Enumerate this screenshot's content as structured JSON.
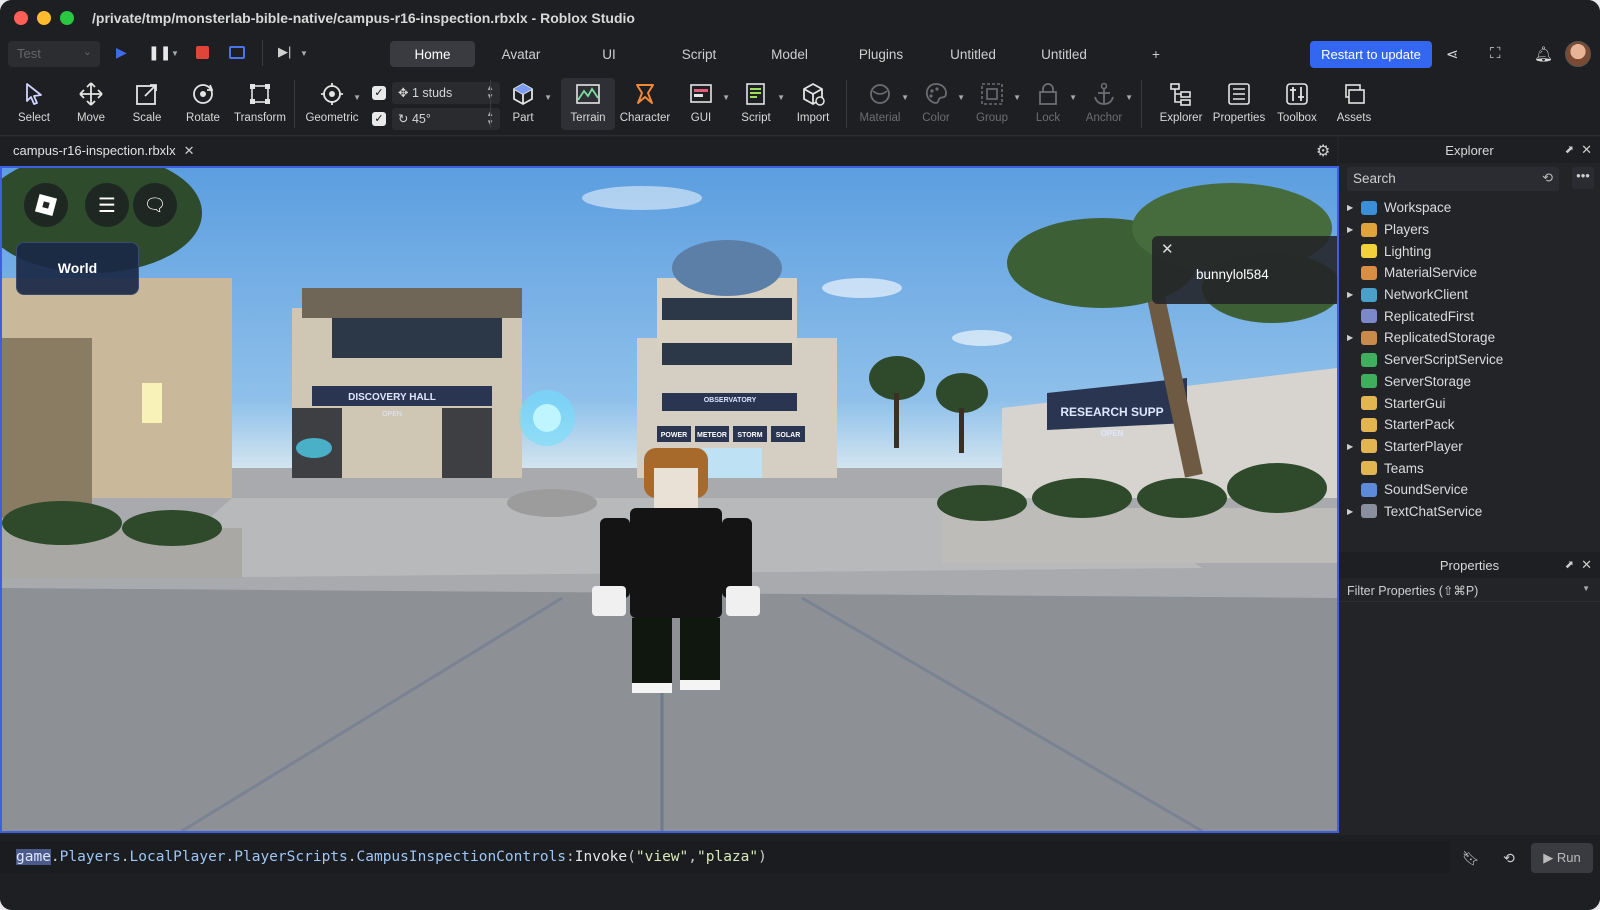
{
  "window": {
    "title": "/private/tmp/monsterlab-bible-native/campus-r16-inspection.rbxlx - Roblox Studio"
  },
  "menubar": {
    "mode_select": "Test",
    "tabs": [
      {
        "label": "Home",
        "active": true
      },
      {
        "label": "Avatar",
        "active": false
      },
      {
        "label": "UI",
        "active": false
      },
      {
        "label": "Script",
        "active": false
      },
      {
        "label": "Model",
        "active": false
      },
      {
        "label": "Plugins",
        "active": false
      },
      {
        "label": "Untitled",
        "active": false
      },
      {
        "label": "Untitled",
        "active": false
      },
      {
        "label": "+",
        "active": false
      }
    ],
    "restart_button": "Restart to update"
  },
  "ribbon": {
    "tools": [
      {
        "label": "Select"
      },
      {
        "label": "Move"
      },
      {
        "label": "Scale"
      },
      {
        "label": "Rotate"
      },
      {
        "label": "Transform"
      },
      {
        "label": "Geometric"
      },
      {
        "label": "Part"
      },
      {
        "label": "Terrain"
      },
      {
        "label": "Character"
      },
      {
        "label": "GUI"
      },
      {
        "label": "Script"
      },
      {
        "label": "Import"
      },
      {
        "label": "Material"
      },
      {
        "label": "Color"
      },
      {
        "label": "Group"
      },
      {
        "label": "Lock"
      },
      {
        "label": "Anchor"
      },
      {
        "label": "Explorer"
      },
      {
        "label": "Properties"
      },
      {
        "label": "Toolbox"
      },
      {
        "label": "Assets"
      }
    ],
    "move_snap": "1 studs",
    "rotate_snap": "45°"
  },
  "document": {
    "tab_label": "campus-r16-inspection.rbxlx"
  },
  "viewport": {
    "world_button": "World",
    "player_name": "bunnylol584",
    "signs": [
      "DISCOVERY HALL",
      "OPEN",
      "OBSERVATORY",
      "POWER",
      "METEOR",
      "STORM",
      "SOLAR",
      "RESEARCH SUPP",
      "OPEN"
    ]
  },
  "explorer": {
    "title": "Explorer",
    "search_placeholder": "Search",
    "items": [
      {
        "label": "Workspace",
        "expandable": true,
        "color": "#3a8fd8"
      },
      {
        "label": "Players",
        "expandable": true,
        "color": "#e0a23a"
      },
      {
        "label": "Lighting",
        "expandable": false,
        "color": "#f2d13b"
      },
      {
        "label": "MaterialService",
        "expandable": false,
        "color": "#d88f45"
      },
      {
        "label": "NetworkClient",
        "expandable": true,
        "color": "#4aa0c8"
      },
      {
        "label": "ReplicatedFirst",
        "expandable": false,
        "color": "#7b88c9"
      },
      {
        "label": "ReplicatedStorage",
        "expandable": true,
        "color": "#c98a4a"
      },
      {
        "label": "ServerScriptService",
        "expandable": false,
        "color": "#3fae5d"
      },
      {
        "label": "ServerStorage",
        "expandable": false,
        "color": "#3fae5d"
      },
      {
        "label": "StarterGui",
        "expandable": false,
        "color": "#e2b552"
      },
      {
        "label": "StarterPack",
        "expandable": false,
        "color": "#e2b552"
      },
      {
        "label": "StarterPlayer",
        "expandable": true,
        "color": "#e2b552"
      },
      {
        "label": "Teams",
        "expandable": false,
        "color": "#e2b552"
      },
      {
        "label": "SoundService",
        "expandable": false,
        "color": "#5d8bd9"
      },
      {
        "label": "TextChatService",
        "expandable": true,
        "color": "#8a8fa0"
      }
    ]
  },
  "properties": {
    "title": "Properties",
    "filter_placeholder": "Filter Properties (⇧⌘P)"
  },
  "command_bar": {
    "tokens": [
      {
        "text": "game",
        "kind": "kw"
      },
      {
        "text": ".",
        "kind": "plain"
      },
      {
        "text": "Players",
        "kind": "id"
      },
      {
        "text": ".",
        "kind": "plain"
      },
      {
        "text": "LocalPlayer",
        "kind": "id"
      },
      {
        "text": ".",
        "kind": "plain"
      },
      {
        "text": "PlayerScripts",
        "kind": "id"
      },
      {
        "text": ".",
        "kind": "plain"
      },
      {
        "text": "CampusInspectionControls",
        "kind": "id"
      },
      {
        "text": ":",
        "kind": "plain"
      },
      {
        "text": "Invoke",
        "kind": "fn"
      },
      {
        "text": "(",
        "kind": "plain"
      },
      {
        "text": "\"view\"",
        "kind": "str"
      },
      {
        "text": ",",
        "kind": "plain"
      },
      {
        "text": "\"plaza\"",
        "kind": "str"
      },
      {
        "text": ")",
        "kind": "plain"
      }
    ],
    "run_button": "Run"
  },
  "colors": {
    "accent": "#3367f2",
    "viewport_border": "#3d5fe0"
  }
}
